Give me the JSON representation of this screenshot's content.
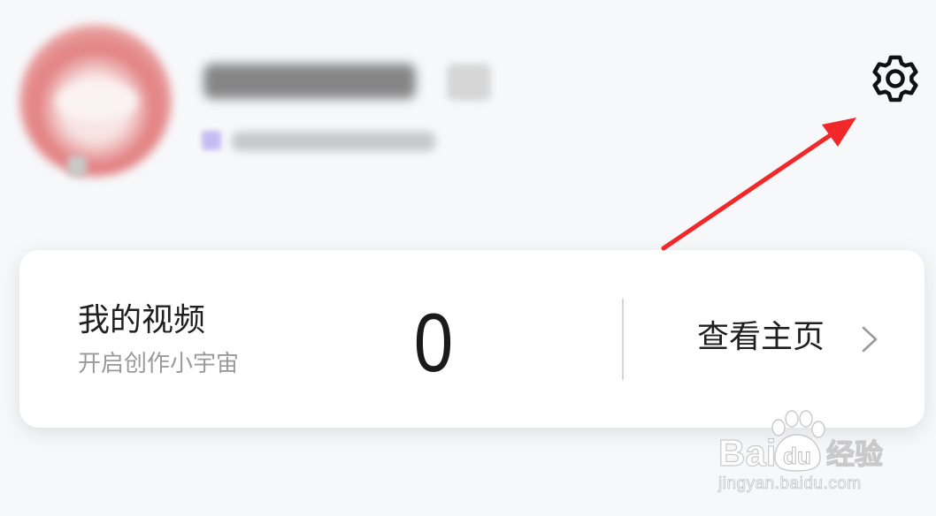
{
  "profile": {
    "avatar_icon": "avatar-icon",
    "badge_icon": "level-badge-icon",
    "vip_icon": "vip-icon"
  },
  "header": {
    "settings_icon": "gear-icon"
  },
  "video_card": {
    "title": "我的视频",
    "subtitle": "开启创作小宇宙",
    "video_count": 0,
    "view_homepage": "查看主页",
    "chevron_icon": "chevron-right-icon"
  },
  "annotation": {
    "arrow_icon": "red-arrow",
    "color": "#f0282a"
  },
  "watermark": {
    "logo_left": "Bai",
    "logo_paw_text": "du",
    "product": "经验",
    "url": "jingyan.baidu.com"
  },
  "colors": {
    "page_background": "#f7f8fa",
    "card_background": "#ffffff",
    "text_primary": "#1f1f1f",
    "text_secondary": "#9a9a9a",
    "divider": "#d6d6d6",
    "avatar_accent": "#e27f80"
  }
}
